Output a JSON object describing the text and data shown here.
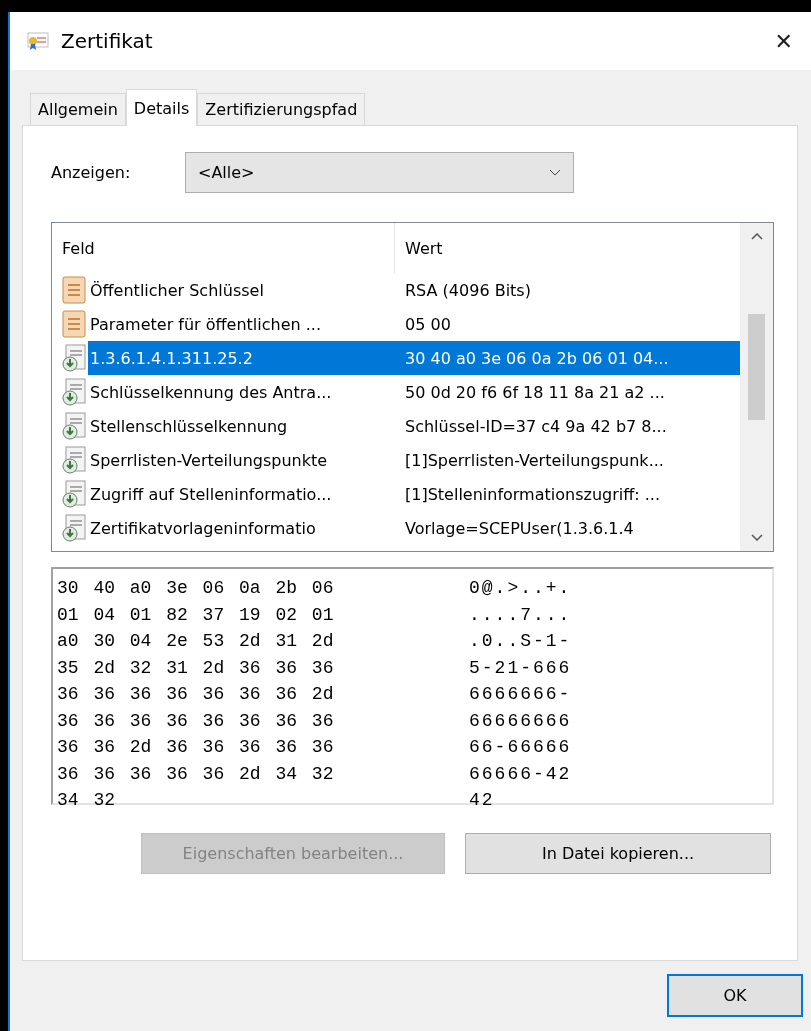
{
  "window": {
    "title": "Zertifikat",
    "close": "✕"
  },
  "tabs": [
    {
      "label": "Allgemein",
      "selected": false
    },
    {
      "label": "Details",
      "selected": true
    },
    {
      "label": "Zertifizierungspfad",
      "selected": false
    }
  ],
  "show": {
    "label": "Anzeigen:",
    "value": "<Alle>"
  },
  "fields": {
    "columns": [
      "Feld",
      "Wert"
    ],
    "rows": [
      {
        "kind": "property",
        "field": "Öffentlicher Schlüssel",
        "value": "RSA (4096 Bits)",
        "selected": false
      },
      {
        "kind": "property",
        "field": "Parameter für öffentlichen ...",
        "value": "05 00",
        "selected": false
      },
      {
        "kind": "extension",
        "field": "1.3.6.1.4.1.311.25.2",
        "value": "30 40 a0 3e 06 0a 2b 06 01 04...",
        "selected": true
      },
      {
        "kind": "extension",
        "field": "Schlüsselkennung des Antra...",
        "value": "50 0d 20 f6 6f 18 11 8a 21 a2 ...",
        "selected": false
      },
      {
        "kind": "extension",
        "field": "Stellenschlüsselkennung",
        "value": "Schlüssel-ID=37 c4 9a 42 b7 8...",
        "selected": false
      },
      {
        "kind": "extension",
        "field": "Sperrlisten-Verteilungspunkte",
        "value": "[1]Sperrlisten-Verteilungspunk...",
        "selected": false
      },
      {
        "kind": "extension",
        "field": "Zugriff auf Stelleninformatio...",
        "value": "[1]Stelleninformationszugriff: ...",
        "selected": false
      },
      {
        "kind": "extension",
        "field": "Zertifikatvorlageninformatio",
        "value": "Vorlage=SCEPUser(1.3.6.1.4",
        "selected": false
      }
    ]
  },
  "hex_dump": [
    {
      "hex": "30 40 a0 3e 06 0a 2b 06",
      "ascii": "0@.>..+."
    },
    {
      "hex": "01 04 01 82 37 19 02 01",
      "ascii": "....7..."
    },
    {
      "hex": "a0 30 04 2e 53 2d 31 2d",
      "ascii": ".0..S-1-"
    },
    {
      "hex": "35 2d 32 31 2d 36 36 36",
      "ascii": "5-21-666"
    },
    {
      "hex": "36 36 36 36 36 36 36 2d",
      "ascii": "6666666-"
    },
    {
      "hex": "36 36 36 36 36 36 36 36",
      "ascii": "66666666"
    },
    {
      "hex": "36 36 2d 36 36 36 36 36",
      "ascii": "66-66666"
    },
    {
      "hex": "36 36 36 36 36 2d 34 32",
      "ascii": "66666-42"
    },
    {
      "hex": "34 32",
      "ascii": "42"
    }
  ],
  "buttons": [
    {
      "label": "Eigenschaften bearbeiten...",
      "disabled": true
    },
    {
      "label": "In Datei kopieren...",
      "disabled": false
    }
  ],
  "ok": {
    "label": "OK"
  }
}
